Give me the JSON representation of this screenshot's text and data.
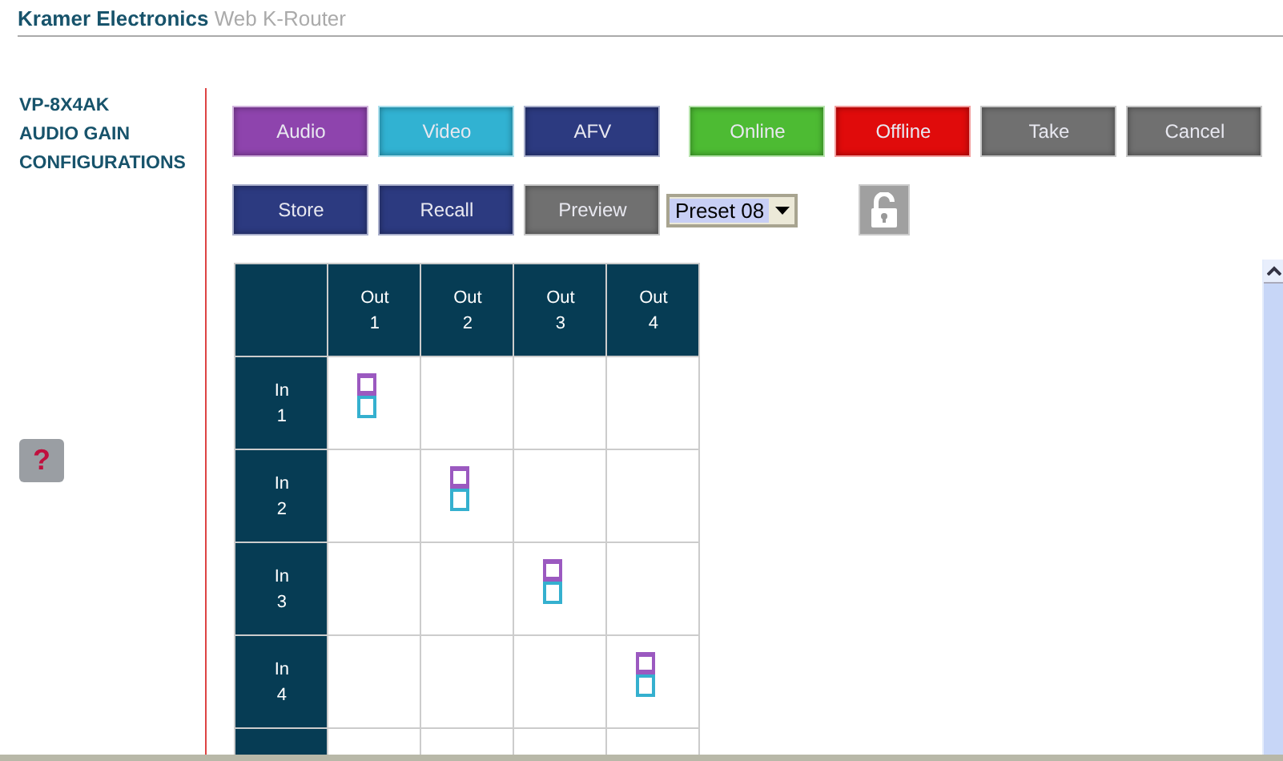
{
  "header": {
    "brand": "Kramer Electronics",
    "product": "Web K-Router"
  },
  "sidebar": {
    "items": [
      {
        "label": "VP-8X4AK"
      },
      {
        "label": "AUDIO GAIN"
      },
      {
        "label": "CONFIGURATIONS"
      }
    ],
    "help": "?"
  },
  "toolbar": {
    "row_1": [
      {
        "label": "Audio",
        "color": "#8e44ad"
      },
      {
        "label": "Video",
        "color": "#31b2d2"
      },
      {
        "label": "AFV",
        "color": "#2c3a80"
      },
      {
        "label": "Online",
        "color": "#4dbb33"
      },
      {
        "label": "Offline",
        "color": "#e00b0b"
      },
      {
        "label": "Take",
        "color": "#707070"
      },
      {
        "label": "Cancel",
        "color": "#707070"
      }
    ],
    "row_2": [
      {
        "label": "Store",
        "color": "#2c3a80"
      },
      {
        "label": "Recall",
        "color": "#2c3a80"
      },
      {
        "label": "Preview",
        "color": "#707070"
      }
    ],
    "preset": {
      "value": "Preset 08"
    },
    "lock": {
      "locked": false
    }
  },
  "matrix": {
    "columns": [
      {
        "label": "Out",
        "number": "1"
      },
      {
        "label": "Out",
        "number": "2"
      },
      {
        "label": "Out",
        "number": "3"
      },
      {
        "label": "Out",
        "number": "4"
      }
    ],
    "rows": [
      {
        "label": "In",
        "number": "1",
        "cells": [
          {
            "audio": true,
            "video": true
          },
          {
            "audio": false,
            "video": false
          },
          {
            "audio": false,
            "video": false
          },
          {
            "audio": false,
            "video": false
          }
        ]
      },
      {
        "label": "In",
        "number": "2",
        "cells": [
          {
            "audio": false,
            "video": false
          },
          {
            "audio": true,
            "video": true
          },
          {
            "audio": false,
            "video": false
          },
          {
            "audio": false,
            "video": false
          }
        ]
      },
      {
        "label": "In",
        "number": "3",
        "cells": [
          {
            "audio": false,
            "video": false
          },
          {
            "audio": false,
            "video": false
          },
          {
            "audio": true,
            "video": true
          },
          {
            "audio": false,
            "video": false
          }
        ]
      },
      {
        "label": "In",
        "number": "4",
        "cells": [
          {
            "audio": false,
            "video": false
          },
          {
            "audio": false,
            "video": false
          },
          {
            "audio": false,
            "video": false
          },
          {
            "audio": true,
            "video": true
          }
        ]
      },
      {
        "cells": [
          {
            "audio": false,
            "video": false
          },
          {
            "audio": false,
            "video": false
          },
          {
            "audio": false,
            "video": false
          },
          {
            "audio": false,
            "video": false
          }
        ]
      }
    ]
  }
}
